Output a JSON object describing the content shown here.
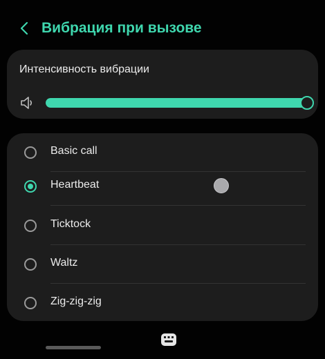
{
  "header": {
    "back_icon": "chevron-left-icon",
    "title": "Вибрация при вызове"
  },
  "intensity": {
    "label": "Интенсивность вибрации",
    "icon": "speaker-icon",
    "level_percent": 100
  },
  "patterns": {
    "items": [
      {
        "label": "Basic call",
        "selected": false
      },
      {
        "label": "Heartbeat",
        "selected": true
      },
      {
        "label": "Ticktock",
        "selected": false
      },
      {
        "label": "Waltz",
        "selected": false
      },
      {
        "label": "Zig-zig-zig",
        "selected": false
      }
    ]
  },
  "nav": {
    "keyboard_icon": "keyboard-icon"
  },
  "colors": {
    "accent": "#3fd7ae",
    "background": "#020202",
    "card": "#1d1d1d"
  }
}
